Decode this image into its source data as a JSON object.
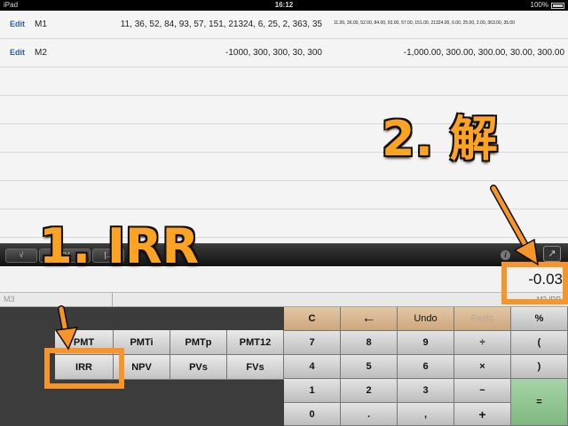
{
  "status_bar": {
    "device": "iPad",
    "time": "16:12",
    "battery": "100%"
  },
  "rows": [
    {
      "edit": "Edit",
      "name": "M1",
      "values": "11, 36, 52, 84, 93, 57, 151, 21324, 6, 25, 2, 363, 35",
      "formatted": "11.00, 36.00, 52.00, 84.00, 93.00, 57.00, 151.00, 21324.00, 6.00, 25.00, 2.00, 363.00, 35.00"
    },
    {
      "edit": "Edit",
      "name": "M2",
      "values": "-1000, 300, 300, 30, 300",
      "formatted": "-1,000.00, 300.00, 300.00, 30.00, 300.00"
    }
  ],
  "toolbar": {
    "buttons": [
      "√",
      "SV",
      "[..]"
    ],
    "info_icon": "i",
    "share_icon": "↗"
  },
  "display": {
    "result": "-0.03",
    "subtitle": "M2 IRR",
    "memory_label": "M3"
  },
  "keypad_left": [
    [
      "PMT",
      "PMTi",
      "PMTp",
      "PMT12"
    ],
    [
      "IRR",
      "NPV",
      "PVs",
      "FVs"
    ]
  ],
  "keypad_right": [
    [
      "C",
      "←",
      "Undo",
      "Redo",
      "%"
    ],
    [
      "7",
      "8",
      "9",
      "÷",
      "("
    ],
    [
      "4",
      "5",
      "6",
      "×",
      ")"
    ],
    [
      "1",
      "2",
      "3",
      "−",
      "="
    ],
    [
      "0",
      ".",
      ",",
      "+"
    ]
  ],
  "annotations": {
    "step1": "1. IRR",
    "step2": "2. 解"
  },
  "colors": {
    "annotation": "#f7952a",
    "accent_key": "#cda77e",
    "equals_key": "#7eb87e"
  }
}
